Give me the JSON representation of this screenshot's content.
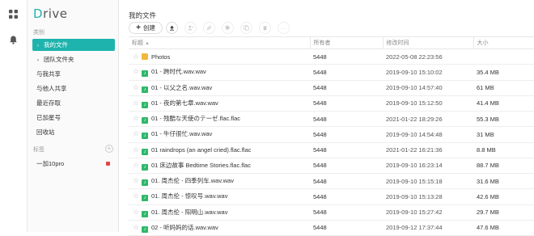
{
  "app": {
    "logo_first": "D",
    "logo_rest": "rive"
  },
  "rail": {
    "apps_icon": "grid-icon",
    "bell_icon": "bell-icon"
  },
  "sidebar": {
    "category_label": "类别",
    "items": [
      {
        "label": "我的文件",
        "caret": "›",
        "active": true
      },
      {
        "label": "团队文件夹",
        "caret": "›",
        "active": false
      },
      {
        "label": "与我共享",
        "caret": "",
        "active": false
      },
      {
        "label": "与他人共享",
        "caret": "",
        "active": false
      },
      {
        "label": "最近存取",
        "caret": "",
        "active": false
      },
      {
        "label": "已加星号",
        "caret": "",
        "active": false
      },
      {
        "label": "回收站",
        "caret": "",
        "active": false
      }
    ],
    "tags_label": "标签",
    "tags": [
      {
        "label": "一加10pro",
        "color": "#e44444"
      }
    ]
  },
  "main": {
    "title": "我的文件",
    "toolbar": {
      "create_label": "创建",
      "icons": [
        "upload-icon",
        "share-user-icon",
        "link-icon",
        "tag-icon",
        "copy-icon",
        "delete-icon",
        "more-icon"
      ]
    },
    "columns": {
      "name": "标题",
      "owner": "所有者",
      "modified": "修改时间",
      "size": "大小"
    },
    "rows": [
      {
        "type": "folder",
        "name": "Photos",
        "owner": "5448",
        "modified": "2022-05-08 22:23:56",
        "size": ""
      },
      {
        "type": "audio",
        "name": "01 - 跨时代.wav.wav",
        "owner": "5448",
        "modified": "2019-09-10 15:10:02",
        "size": "35.4 MB"
      },
      {
        "type": "audio",
        "name": "01 - 以父之名.wav.wav",
        "owner": "5448",
        "modified": "2019-09-10 14:57:40",
        "size": "61 MB"
      },
      {
        "type": "audio",
        "name": "01 - 夜的第七章.wav.wav",
        "owner": "5448",
        "modified": "2019-09-10 15:12:50",
        "size": "41.4 MB"
      },
      {
        "type": "audio",
        "name": "01 - 残酷な天使のテーゼ.flac.flac",
        "owner": "5448",
        "modified": "2021-01-22 18:29:26",
        "size": "55.3 MB"
      },
      {
        "type": "audio",
        "name": "01 - 牛仔很忙.wav.wav",
        "owner": "5448",
        "modified": "2019-09-10 14:54:48",
        "size": "31 MB"
      },
      {
        "type": "audio",
        "name": "01 raindrops (an angel cried).flac.flac",
        "owner": "5448",
        "modified": "2021-01-22 16:21:36",
        "size": "8.8 MB"
      },
      {
        "type": "audio",
        "name": "01 床边故事 Bedtime Stories.flac.flac",
        "owner": "5448",
        "modified": "2019-09-10 16:23:14",
        "size": "88.7 MB"
      },
      {
        "type": "audio",
        "name": "01. 周杰伦 - 四季列车.wav.wav",
        "owner": "5448",
        "modified": "2019-09-10 15:15:18",
        "size": "31.6 MB"
      },
      {
        "type": "audio",
        "name": "01. 周杰伦 - 惊叹号.wav.wav",
        "owner": "5448",
        "modified": "2019-09-10 15:13:28",
        "size": "42.6 MB"
      },
      {
        "type": "audio",
        "name": "01. 周杰伦 - 阳明山.wav.wav",
        "owner": "5448",
        "modified": "2019-09-10 15:27:42",
        "size": "29.7 MB"
      },
      {
        "type": "audio",
        "name": "02 - 听妈妈的话.wav.wav",
        "owner": "5448",
        "modified": "2019-09-12 17:37:44",
        "size": "47.6 MB"
      }
    ]
  }
}
